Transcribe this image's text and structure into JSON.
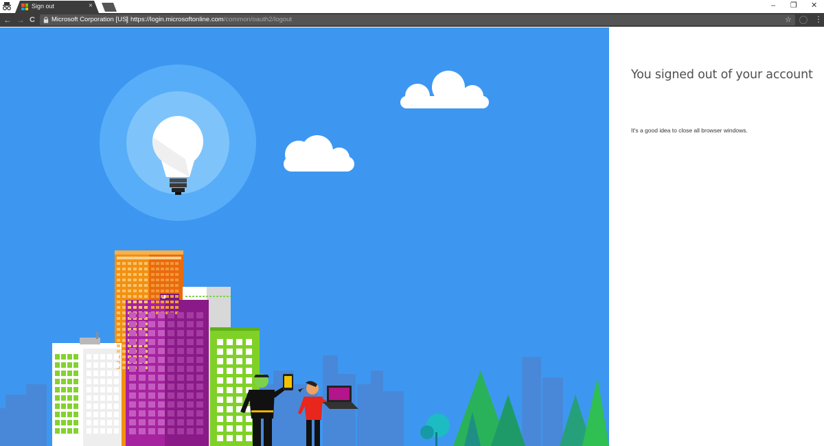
{
  "browser": {
    "tab": {
      "title": "Sign out",
      "close_glyph": "×"
    },
    "window_controls": {
      "minimize": "–",
      "restore": "❐",
      "close": "✕"
    },
    "nav": {
      "back": "←",
      "forward": "→",
      "reload": "C"
    },
    "omnibox": {
      "org_name": "Microsoft Corporation [US]",
      "url_host": "https://login.microsoftonline.com",
      "url_path": "/common/oauth2/logout"
    },
    "toolbar_icons": {
      "star": "☆",
      "menu": "⋮"
    }
  },
  "panel": {
    "title": "You signed out of your account",
    "note": "It's a good idea to close all browser windows."
  },
  "illustration": {
    "subject": "city skyline with lightbulb, clouds, trees and two people with devices",
    "colors": {
      "sky": "#3d97f0",
      "bulb_halo_outer": "#5ab0f8",
      "bulb_halo_inner": "#7cc4fb",
      "orange_building": "#f28c13",
      "purple_building": "#a4209f",
      "green_building": "#7bd124",
      "trees": "#2ab553"
    }
  }
}
